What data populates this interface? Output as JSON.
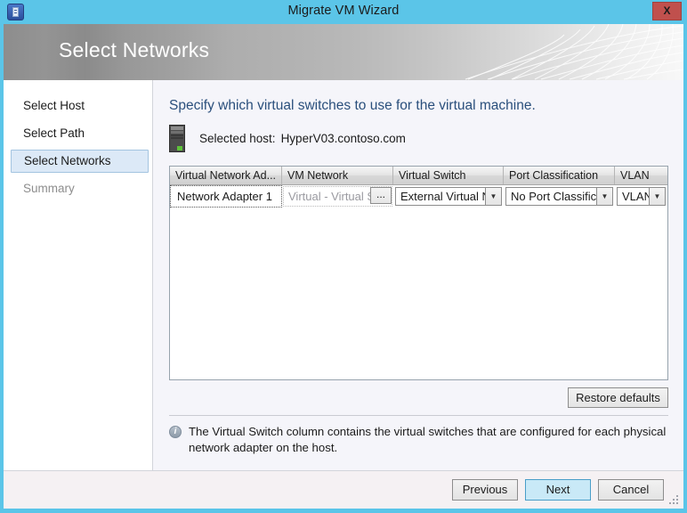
{
  "window": {
    "title": "Migrate VM Wizard",
    "app_icon": "server-document-icon",
    "close_label": "X",
    "accent_color": "#5bc5e8",
    "close_color": "#c0504d"
  },
  "banner": {
    "title": "Select Networks"
  },
  "sidebar": {
    "items": [
      {
        "label": "Select Host",
        "state": "normal"
      },
      {
        "label": "Select Path",
        "state": "normal"
      },
      {
        "label": "Select Networks",
        "state": "selected"
      },
      {
        "label": "Summary",
        "state": "disabled"
      }
    ]
  },
  "main": {
    "heading": "Specify which virtual switches to use for the virtual machine.",
    "host": {
      "icon": "server-tower-icon",
      "label": "Selected host:",
      "name": "HyperV03.contoso.com"
    },
    "grid": {
      "columns": [
        "Virtual Network Ad...",
        "VM Network",
        "Virtual Switch",
        "Port Classification",
        "VLAN"
      ],
      "rows": [
        {
          "adapter": "Network Adapter 1",
          "vm_network": "Virtual - Virtual Swi",
          "vm_network_browse": "...",
          "virtual_switch": "External Virtual Ne",
          "port_classification": "No Port Classifica",
          "vlan": "VLAN"
        }
      ]
    },
    "restore_defaults_label": "Restore defaults",
    "info": {
      "icon": "info-circle-icon",
      "text": "The Virtual Switch column contains the virtual switches that are configured for each physical network adapter on the host."
    }
  },
  "footer": {
    "previous_label": "Previous",
    "next_label": "Next",
    "cancel_label": "Cancel"
  }
}
